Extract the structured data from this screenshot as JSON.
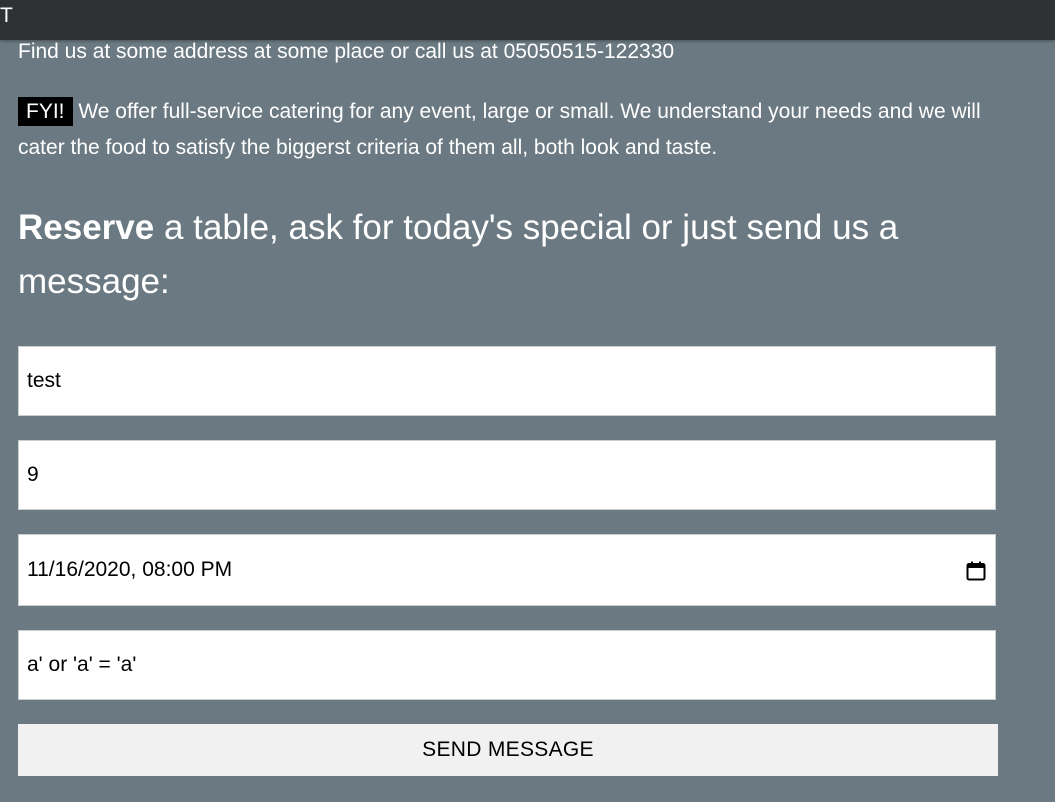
{
  "nav": {
    "cut_item": "T"
  },
  "contact": {
    "address_text": "Find us at some address at some place or call us at 05050515-122330",
    "fyi_tag": "FYI!",
    "fyi_text": " We offer full-service catering for any event, large or small. We understand your needs and we will cater the food to satisfy the biggerst criteria of them all, both look and taste."
  },
  "reserve": {
    "heading_bold": "Reserve",
    "heading_rest": " a table, ask for today's special or just send us a message:"
  },
  "form": {
    "name_value": "test",
    "people_value": "9",
    "datetime_value": "11/16/2020, 08:00 PM",
    "datetime_icon": "calendar-icon",
    "message_value": "a' or 'a' = 'a'",
    "submit_label": "SEND MESSAGE"
  },
  "colors": {
    "page_background": "#6b7a82",
    "topbar_background": "#2e3235",
    "fyi_background": "#000000",
    "button_background": "#f1f1f1"
  }
}
